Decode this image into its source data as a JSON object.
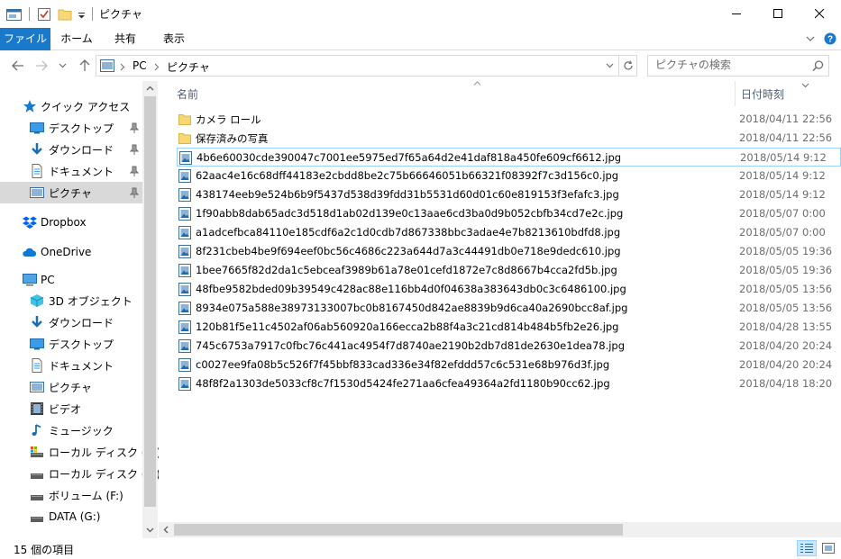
{
  "window": {
    "title": "ピクチャ",
    "minimize_icon": "minimize-icon",
    "maximize_icon": "maximize-icon",
    "close_icon": "close-icon"
  },
  "ribbon": {
    "tabs": [
      {
        "label": "ファイル"
      },
      {
        "label": "ホーム"
      },
      {
        "label": "共有"
      },
      {
        "label": "表示"
      }
    ]
  },
  "address": {
    "crumbs": [
      "PC",
      "ピクチャ"
    ]
  },
  "search": {
    "placeholder": "ピクチャの検索"
  },
  "nav": {
    "items": [
      {
        "label": "クイック アクセス",
        "icon": "star-icon"
      },
      {
        "label": "デスクトップ",
        "icon": "desktop-icon",
        "pinned": true
      },
      {
        "label": "ダウンロード",
        "icon": "download-icon",
        "pinned": true
      },
      {
        "label": "ドキュメント",
        "icon": "document-icon",
        "pinned": true
      },
      {
        "label": "ピクチャ",
        "icon": "pictures-icon",
        "pinned": true,
        "selected": true
      },
      {
        "label": "Dropbox",
        "icon": "dropbox-icon"
      },
      {
        "label": "OneDrive",
        "icon": "onedrive-icon"
      },
      {
        "label": "PC",
        "icon": "pc-icon"
      },
      {
        "label": "3D オブジェクト",
        "icon": "3d-objects-icon"
      },
      {
        "label": "ダウンロード",
        "icon": "download-icon"
      },
      {
        "label": "デスクトップ",
        "icon": "desktop-icon"
      },
      {
        "label": "ドキュメント",
        "icon": "document-icon"
      },
      {
        "label": "ピクチャ",
        "icon": "pictures-icon"
      },
      {
        "label": "ビデオ",
        "icon": "video-icon"
      },
      {
        "label": "ミュージック",
        "icon": "music-icon"
      },
      {
        "label": "ローカル ディスク (C:)",
        "icon": "system-drive-icon"
      },
      {
        "label": "ローカル ディスク (E:)",
        "icon": "drive-icon"
      },
      {
        "label": "ボリューム (F:)",
        "icon": "drive-icon"
      },
      {
        "label": "DATA (G:)",
        "icon": "drive-icon"
      }
    ]
  },
  "columns": {
    "name": "名前",
    "date": "日付時刻"
  },
  "files": [
    {
      "name": "カメラ ロール",
      "date": "2018/04/11 22:56",
      "type": "folder"
    },
    {
      "name": "保存済みの写真",
      "date": "2018/04/11 22:56",
      "type": "folder"
    },
    {
      "name": "4b6e60030cde390047c7001ee5975ed7f65a64d2e41daf818a450fe609cf6612.jpg",
      "date": "2018/05/14 9:12",
      "type": "image",
      "selected": true
    },
    {
      "name": "62aac4e16c68dff44183e2cbdd8be2c75b66646051b66321f08392f7c3d156c0.jpg",
      "date": "2018/05/14 9:12",
      "type": "image"
    },
    {
      "name": "438174eeb9e524b6b9f5437d538d39fdd31b5531d60d01c60e819153f3efafc3.jpg",
      "date": "2018/05/14 9:12",
      "type": "image"
    },
    {
      "name": "1f90abb8dab65adc3d518d1ab02d139e0c13aae6cd3ba0d9b052cbfb34cd7e2c.jpg",
      "date": "2018/05/07 0:00",
      "type": "image"
    },
    {
      "name": "a1adcefbca84110e185cdf6a2c1d0cdb7d867338bbc3adae4e7b8213610bdfd8.jpg",
      "date": "2018/05/07 0:00",
      "type": "image"
    },
    {
      "name": "8f231cbeb4be9f694eef0bc56c4686c223a644d7a3c44491db0e718e9dedc610.jpg",
      "date": "2018/05/05 19:36",
      "type": "image"
    },
    {
      "name": "1bee7665f82d2da1c5ebceaf3989b61a78e01cefd1872e7c8d8667b4cca2fd5b.jpg",
      "date": "2018/05/05 19:36",
      "type": "image"
    },
    {
      "name": "48fbe9582bded09b39549c428ac88e116bb4d0f04638a383643db0c3c6486100.jpg",
      "date": "2018/05/05 13:56",
      "type": "image"
    },
    {
      "name": "8934e075a588e38973133007bc0b8167450d842ae8839b9d6ca40a2690bcc8af.jpg",
      "date": "2018/05/05 13:56",
      "type": "image"
    },
    {
      "name": "120b81f5e11c4502af06ab560920a166ecca2b88f4a3c21cd814b484b5fb2e26.jpg",
      "date": "2018/04/28 13:55",
      "type": "image"
    },
    {
      "name": "745c6753a7917c0fbc76c441ac4954f7d8740ae2190b2db7d81de2630e1dea78.jpg",
      "date": "2018/04/20 20:24",
      "type": "image"
    },
    {
      "name": "c0027ee9fa08b5c526f7f45bbf833cad336e34f82efddd57c6c531e68b976d3f.jpg",
      "date": "2018/04/20 20:24",
      "type": "image"
    },
    {
      "name": "48f8f2a1303de5033cf8c7f1530d5424fe271aa6cfea49364a2fd1180b90cc62.jpg",
      "date": "2018/04/18 18:20",
      "type": "image"
    }
  ],
  "status": {
    "item_count": "15 個の項目"
  },
  "colors": {
    "accent": "#1979ca",
    "selection_border": "#99d1ff",
    "selection_bg": "#cce8ff",
    "folder": "#f8d775"
  }
}
